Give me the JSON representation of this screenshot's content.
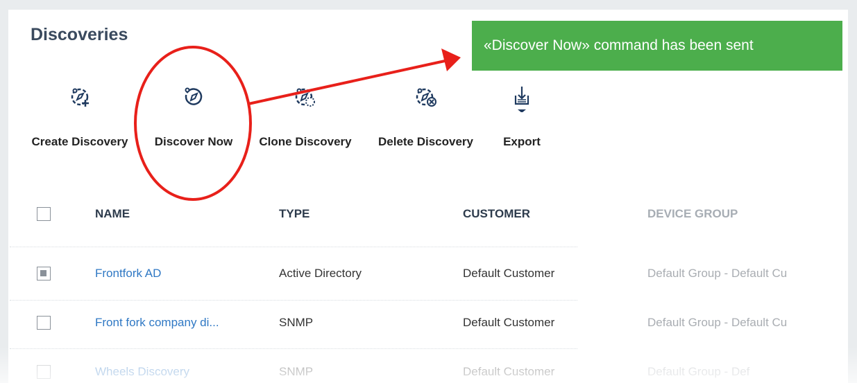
{
  "page": {
    "title": "Discoveries"
  },
  "toolbar": {
    "create": "Create Discovery",
    "discover_now": "Discover Now",
    "clone": "Clone Discovery",
    "delete": "Delete Discovery",
    "export": "Export"
  },
  "toast": {
    "message": "«Discover Now» command has been sent",
    "color": "#4cae4c"
  },
  "table": {
    "headers": {
      "name": "NAME",
      "type": "TYPE",
      "customer": "CUSTOMER",
      "device_group": "DEVICE GROUP"
    },
    "rows": [
      {
        "name": "Frontfork AD",
        "type": "Active Directory",
        "customer": "Default Customer",
        "device_group": "Default Group - Default Cu",
        "checked": true
      },
      {
        "name": "Front fork company di...",
        "type": "SNMP",
        "customer": "Default Customer",
        "device_group": "Default Group - Default Cu",
        "checked": false
      },
      {
        "name": "Wheels Discovery",
        "type": "SNMP",
        "customer": "Default Customer",
        "device_group": "Default Group - Def",
        "checked": false
      }
    ]
  },
  "colors": {
    "accent": "#2f78c4",
    "icon": "#1f3a5f",
    "annotation": "#e8201a"
  }
}
